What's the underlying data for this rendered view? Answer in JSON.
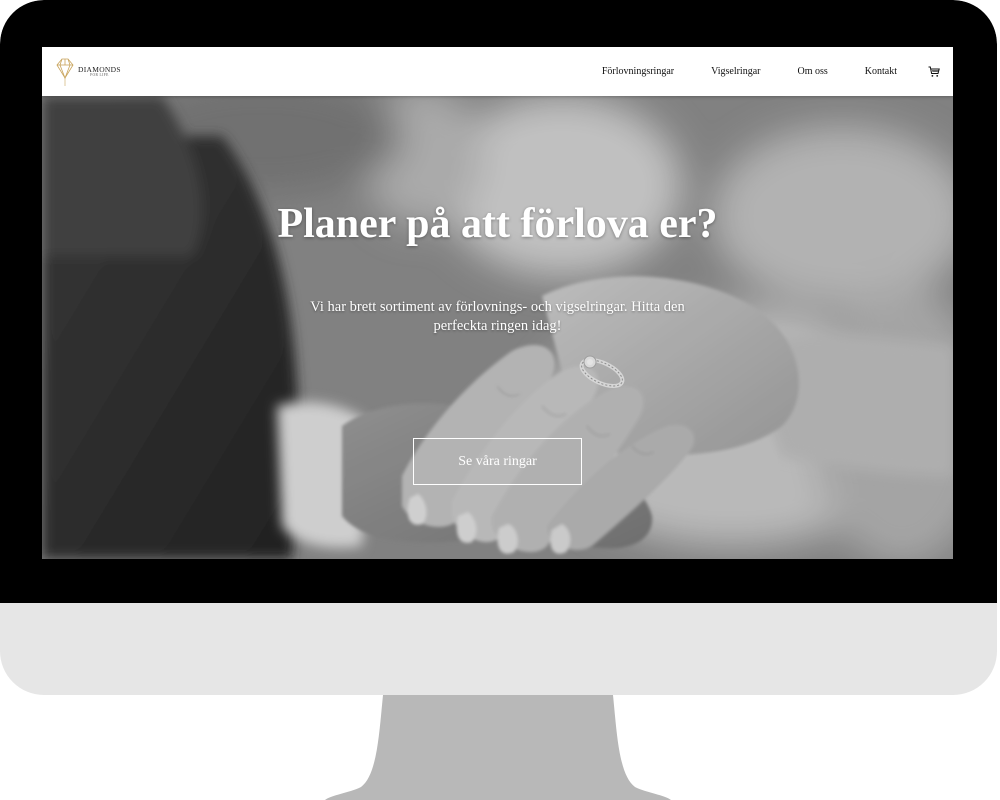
{
  "brand": {
    "name": "DIAMONDS",
    "tagline": "FOR LIFE",
    "logo_icon": "diamond-icon",
    "accent_color": "#c9a45c"
  },
  "nav": {
    "links": [
      {
        "label": "Förlovningsringar"
      },
      {
        "label": "Vigselringar"
      },
      {
        "label": "Om oss"
      },
      {
        "label": "Kontakt"
      }
    ],
    "cart_icon": "shopping-cart-icon"
  },
  "hero": {
    "title": "Planer på att förlova er?",
    "subtitle": "Vi har brett sortiment av förlovnings- och vigselringar. Hitta den perfeckta ringen idag!",
    "cta_label": "Se våra ringar",
    "image": "grayscale-photo-hands-with-engagement-ring"
  },
  "device": {
    "frame": "desktop-monitor-mockup",
    "bezel_color": "#000000",
    "chin_color": "#e6e6e6",
    "stand_color": "#b8b8b8"
  }
}
